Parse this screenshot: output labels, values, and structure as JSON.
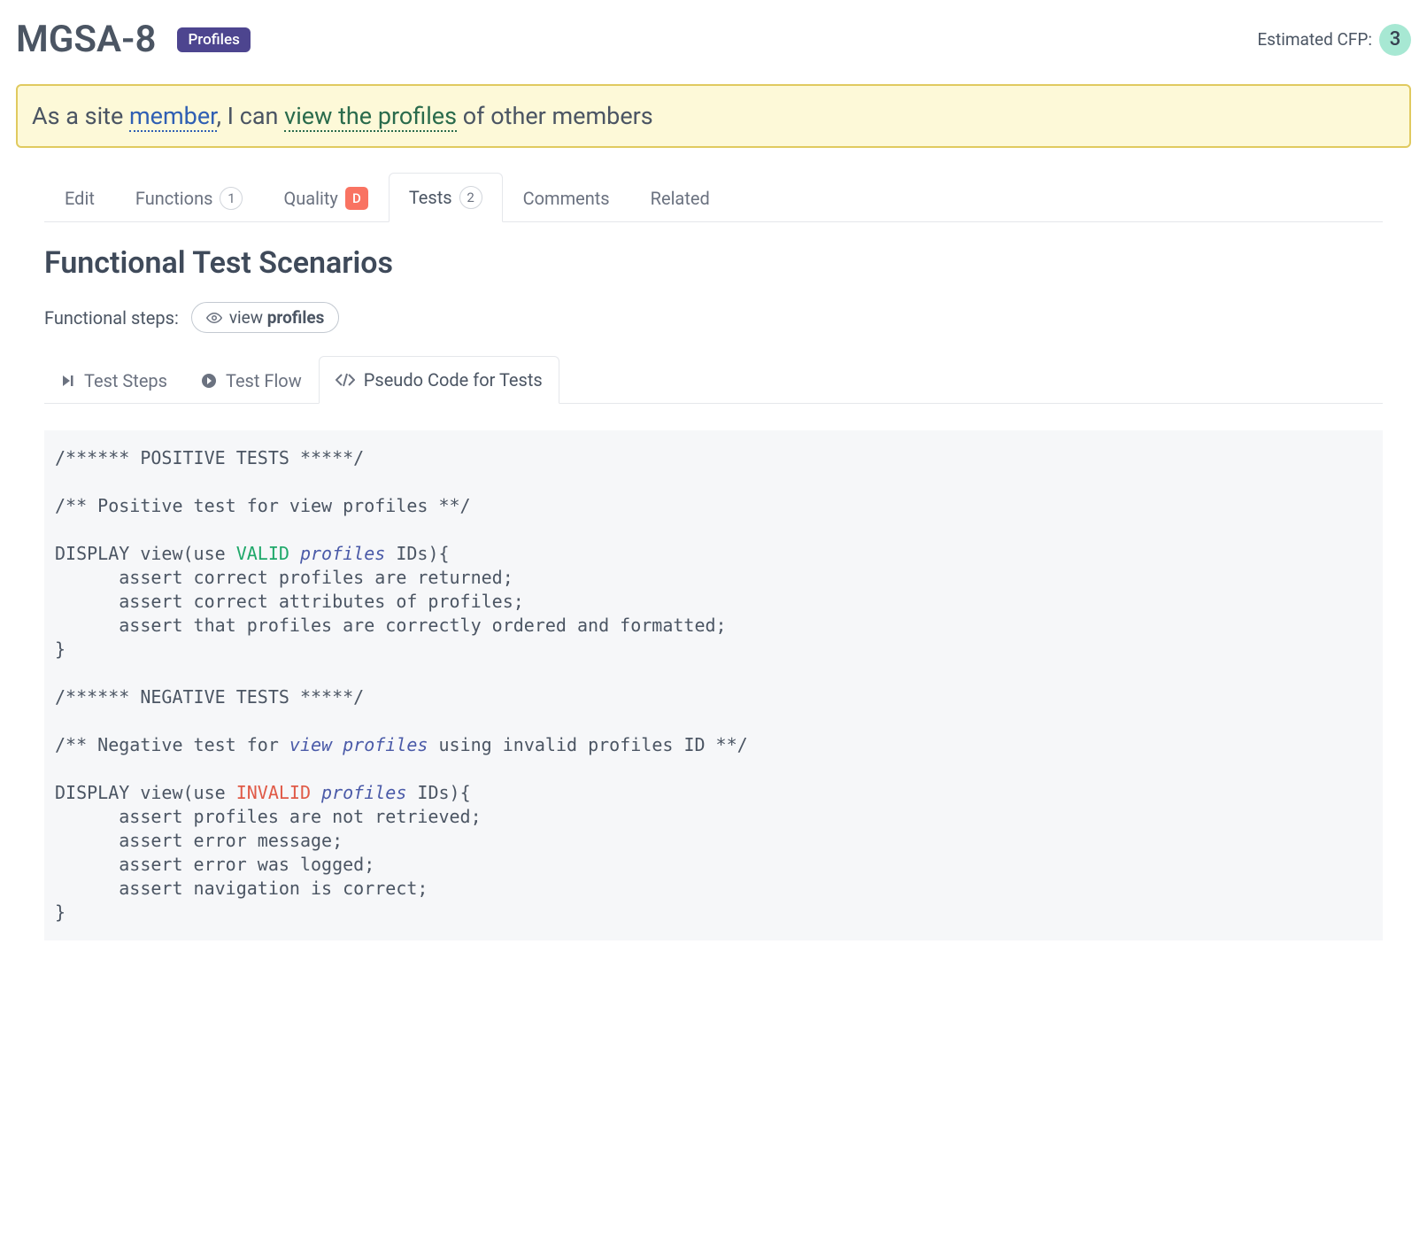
{
  "header": {
    "title": "MGSA-8",
    "badge": "Profiles",
    "cfp_label": "Estimated CFP:",
    "cfp_value": "3"
  },
  "story": {
    "prefix": "As a site ",
    "member": "member",
    "middle": ", I can ",
    "view": "view the profiles",
    "suffix": " of other members"
  },
  "tabs": {
    "edit": "Edit",
    "functions": "Functions",
    "functions_count": "1",
    "quality": "Quality",
    "quality_grade": "D",
    "tests": "Tests",
    "tests_count": "2",
    "comments": "Comments",
    "related": "Related"
  },
  "section": {
    "title": "Functional Test Scenarios",
    "steps_label": "Functional steps:",
    "pill_prefix": "view ",
    "pill_bold": "profiles"
  },
  "subtabs": {
    "steps": "Test Steps",
    "flow": "Test Flow",
    "pseudo": "Pseudo Code for Tests"
  },
  "code": {
    "l01": "/****** POSITIVE TESTS *****/",
    "l02": "",
    "l03": "/** Positive test for view profiles **/",
    "l04": "",
    "l05a": "DISPLAY view(use ",
    "l05_valid": "VALID",
    "l05b": " ",
    "l05_prof": "profiles",
    "l05c": " IDs){",
    "l06": "      assert correct profiles are returned;",
    "l07": "      assert correct attributes of profiles;",
    "l08": "      assert that profiles are correctly ordered and formatted;",
    "l09": "}",
    "l10": "",
    "l11": "/****** NEGATIVE TESTS *****/",
    "l12": "",
    "l13a": "/** Negative test for ",
    "l13_vp": "view profiles",
    "l13b": " using invalid profiles ID **/",
    "l14": "",
    "l15a": "DISPLAY view(use ",
    "l15_invalid": "INVALID",
    "l15b": " ",
    "l15_prof": "profiles",
    "l15c": " IDs){",
    "l16": "      assert profiles are not retrieved;",
    "l17": "      assert error message;",
    "l18": "      assert error was logged;",
    "l19": "      assert navigation is correct;",
    "l20": "}"
  }
}
